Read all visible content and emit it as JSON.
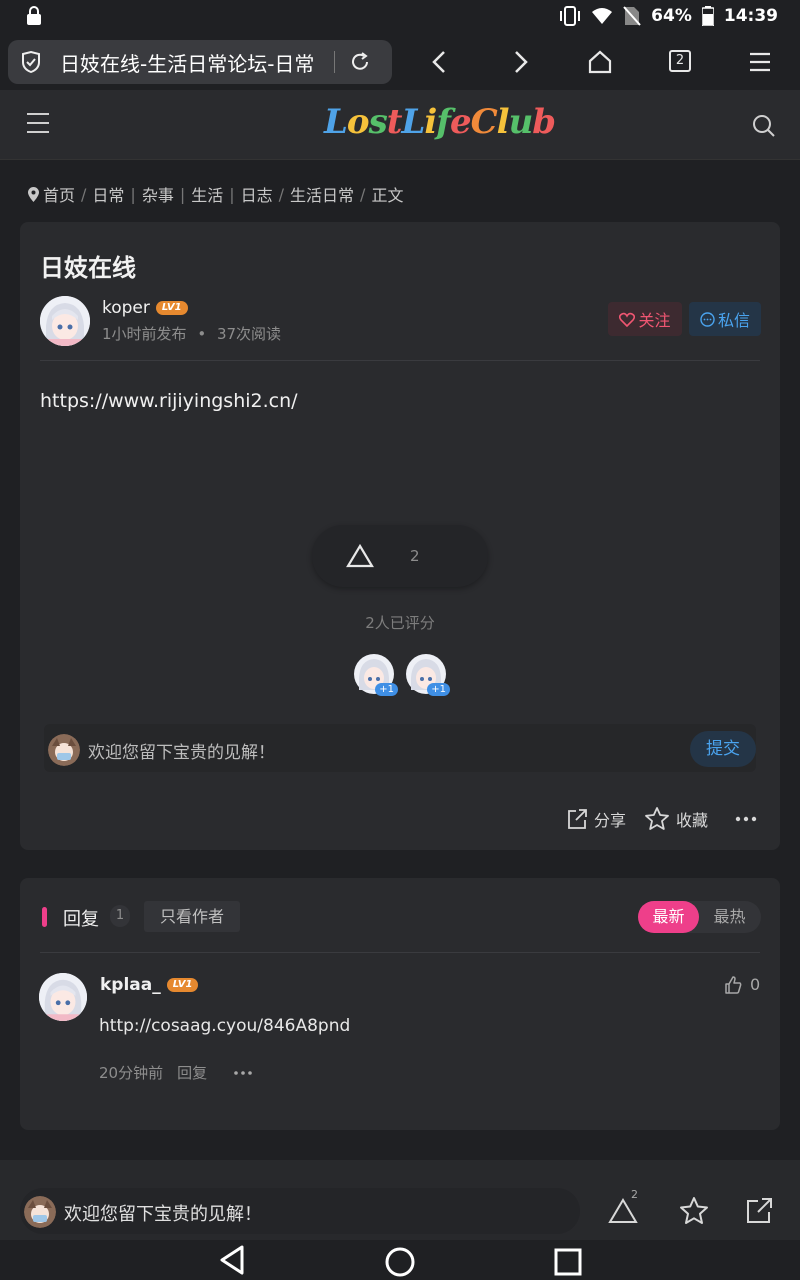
{
  "status": {
    "battery": "64%",
    "time": "14:39"
  },
  "browser": {
    "tab_title": "日妓在线-生活日常论坛-日常",
    "tab_count": "2"
  },
  "site": {
    "logo": "LostLifeClub"
  },
  "breadcrumb": [
    "首页",
    "日常",
    "杂事",
    "生活",
    "日志",
    "生活日常",
    "正文"
  ],
  "post": {
    "title": "日妓在线",
    "author": "koper",
    "level": "LV1",
    "time": "1小时前发布",
    "views": "37次阅读",
    "follow_label": "关注",
    "message_label": "私信",
    "body": "https://www.rijiyingshi2.cn/",
    "rating_count": "2",
    "rated_text": "2人已评分",
    "rater_badge": "+1",
    "comment_placeholder": "欢迎您留下宝贵的见解！",
    "submit_label": "提交",
    "share_label": "分享",
    "favorite_label": "收藏"
  },
  "replies": {
    "title": "回复",
    "count": "1",
    "only_author_label": "只看作者",
    "sort_latest": "最新",
    "sort_hot": "最热",
    "items": [
      {
        "author": "kplaa_",
        "level": "LV1",
        "text": "http://cosaag.cyou/846A8pnd",
        "time": "20分钟前",
        "reply_label": "回复",
        "likes": "0"
      }
    ]
  },
  "bottom": {
    "placeholder": "欢迎您留下宝贵的见解！",
    "rating_count": "2"
  },
  "colors": {
    "accent_pink": "#ee3f8a",
    "accent_blue": "#4aa3ee",
    "follow_red": "#f05672"
  }
}
